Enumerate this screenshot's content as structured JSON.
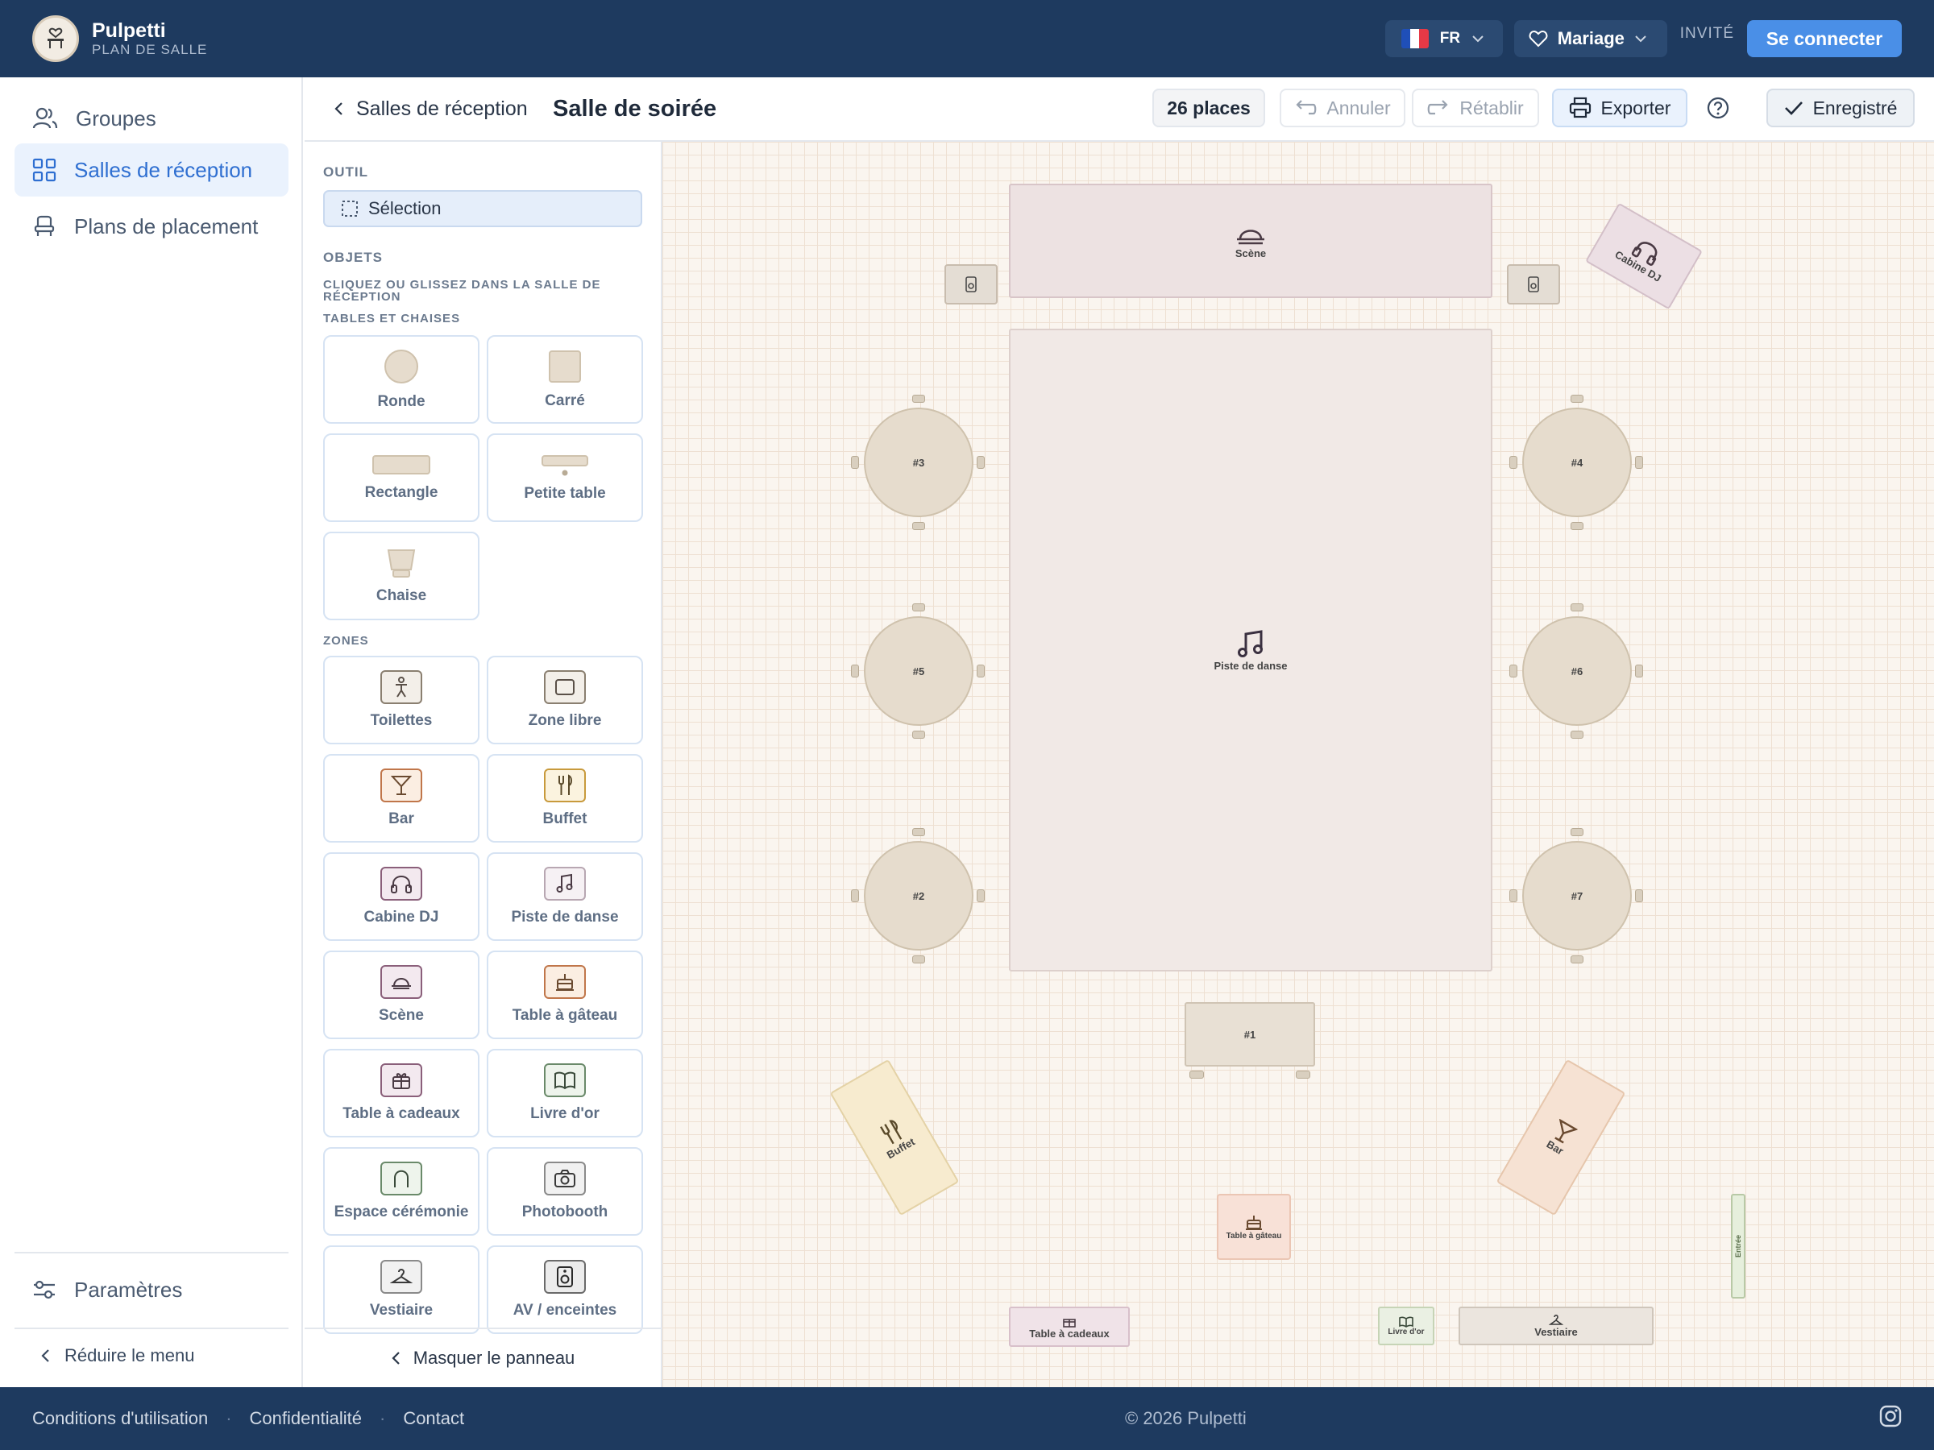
{
  "header": {
    "brand_name": "Pulpetti",
    "brand_subtitle": "PLAN DE SALLE",
    "language": "FR",
    "event_type": "Mariage",
    "guest_label": "INVITÉ",
    "login_label": "Se connecter",
    "flag_colors": [
      "#1f4fb8",
      "#ffffff",
      "#e63946"
    ]
  },
  "sidebar": {
    "items": [
      {
        "label": "Groupes",
        "icon": "users-icon"
      },
      {
        "label": "Salles de réception",
        "icon": "grid-icon",
        "active": true
      },
      {
        "label": "Plans de placement",
        "icon": "seat-icon"
      }
    ],
    "settings_label": "Paramètres",
    "collapse_label": "Réduire le menu"
  },
  "toolbar": {
    "back_label": "Salles de réception",
    "room_title": "Salle de soirée",
    "places": "26 places",
    "undo": "Annuler",
    "redo": "Rétablir",
    "export": "Exporter",
    "saved": "Enregistré"
  },
  "panel": {
    "tool_heading": "OUTIL",
    "selection_label": "Sélection",
    "objects_heading": "OBJETS",
    "objects_hint": "CLIQUEZ OU GLISSEZ DANS LA SALLE DE RÉCEPTION",
    "tables_heading": "TABLES ET CHAISES",
    "tables": [
      "Ronde",
      "Carré",
      "Rectangle",
      "Petite table",
      "Chaise"
    ],
    "zones_heading": "ZONES",
    "zones": [
      {
        "label": "Toilettes",
        "icon": "restroom-icon",
        "color": "#8a7f70"
      },
      {
        "label": "Zone libre",
        "icon": "square-icon",
        "color": "#8a7f70"
      },
      {
        "label": "Bar",
        "icon": "cocktail-icon",
        "color": "#c0764a"
      },
      {
        "label": "Buffet",
        "icon": "cutlery-icon",
        "color": "#c89a3c"
      },
      {
        "label": "Cabine DJ",
        "icon": "headphones-icon",
        "color": "#8a5f7a"
      },
      {
        "label": "Piste de danse",
        "icon": "music-note-icon",
        "color": "#8a6f80"
      },
      {
        "label": "Scène",
        "icon": "stage-icon",
        "color": "#8a5f7a"
      },
      {
        "label": "Table à gâteau",
        "icon": "cake-icon",
        "color": "#c0764a"
      },
      {
        "label": "Table à cadeaux",
        "icon": "gift-icon",
        "color": "#8a5f7a"
      },
      {
        "label": "Livre d'or",
        "icon": "book-icon",
        "color": "#6a8a6a"
      },
      {
        "label": "Espace cérémonie",
        "icon": "arch-icon",
        "color": "#6a8a6a"
      },
      {
        "label": "Photobooth",
        "icon": "camera-icon",
        "color": "#7a7a7a"
      },
      {
        "label": "Vestiaire",
        "icon": "hanger-icon",
        "color": "#7a7a7a"
      },
      {
        "label": "AV / enceintes",
        "icon": "speaker-icon",
        "color": "#5a5a5a"
      }
    ],
    "hide_label": "Masquer le panneau"
  },
  "canvas": {
    "scene": "Scène",
    "dj": "Cabine DJ",
    "dance": "Piste de danse",
    "buffet": "Buffet",
    "bar": "Bar",
    "cake": "Table à gâteau",
    "gifts": "Table à cadeaux",
    "guestbook": "Livre d'or",
    "cloakroom": "Vestiaire",
    "entrance": "Entrée",
    "tables": [
      "#3",
      "#4",
      "#5",
      "#6",
      "#2",
      "#7",
      "#1"
    ]
  },
  "footer": {
    "links": [
      "Conditions d'utilisation",
      "Confidentialité",
      "Contact"
    ],
    "copyright": "© 2026 Pulpetti"
  }
}
